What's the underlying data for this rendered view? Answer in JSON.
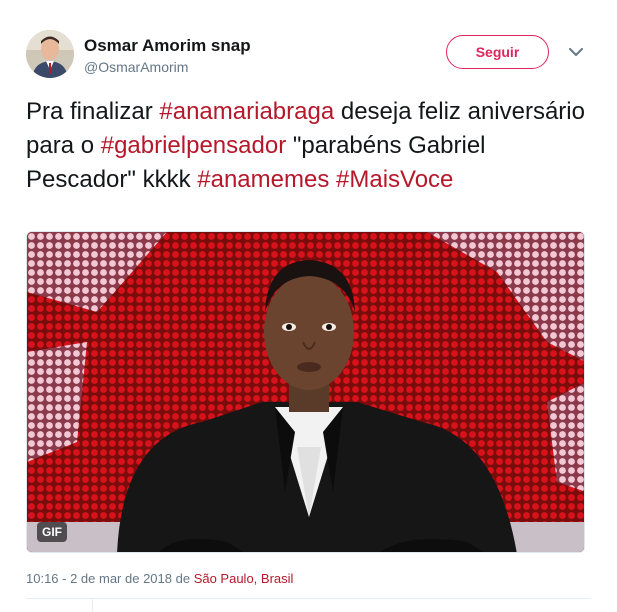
{
  "user": {
    "display_name": "Osmar Amorim snap",
    "handle": "@OsmarAmorim"
  },
  "follow_button": {
    "label": "Seguir"
  },
  "tweet": {
    "segments": [
      {
        "text": "Pra finalizar ",
        "hashtag": false
      },
      {
        "text": "#anamariabraga",
        "hashtag": true
      },
      {
        "text": " deseja feliz aniversário para o ",
        "hashtag": false
      },
      {
        "text": "#gabrielpensador",
        "hashtag": true
      },
      {
        "text": " \"parabéns Gabriel Pescador\" kkkk ",
        "hashtag": false
      },
      {
        "text": "#anamemes",
        "hashtag": true
      },
      {
        "text": " ",
        "hashtag": false
      },
      {
        "text": "#MaisVoce",
        "hashtag": true
      }
    ]
  },
  "media": {
    "badge": "GIF"
  },
  "meta": {
    "timestamp": "10:16 - 2 de mar de 2018 de ",
    "location": "São Paulo, Brasil"
  },
  "icons": {
    "caret": "chevron-down-icon"
  },
  "colors": {
    "accent": "#e0245e",
    "hashtag": "#b5182a",
    "muted": "#657786"
  }
}
